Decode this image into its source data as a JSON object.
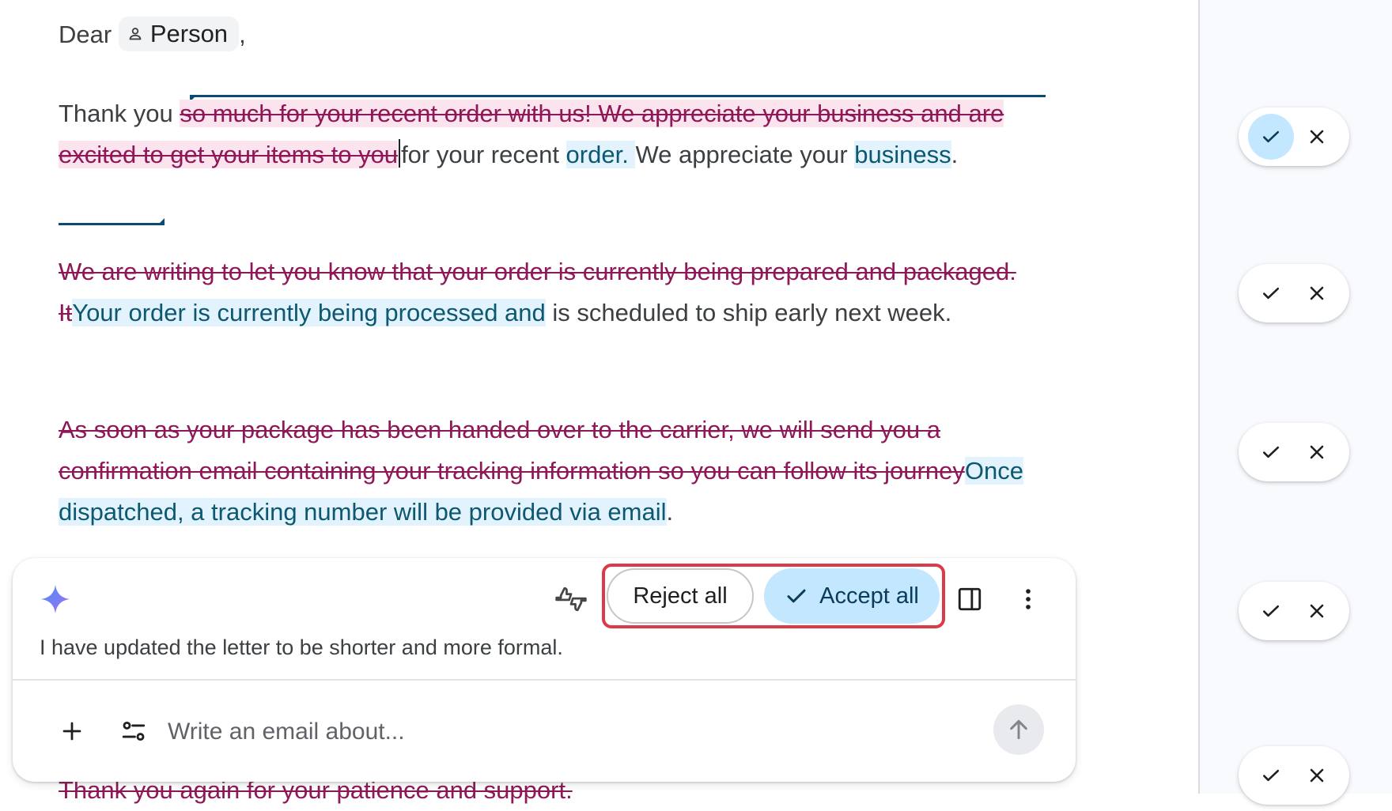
{
  "letter": {
    "greeting_word": "Dear",
    "chip_label": "Person",
    "greeting_punct": ",",
    "p1": {
      "lead": "Thank you ",
      "del1": "so much for your recent order with us! We appreciate your business and are excited to get your items to you",
      "keep1": "for your recent ",
      "ins1": "order. ",
      "keep2": "We appreciate your ",
      "ins2": "business",
      "tail": "."
    },
    "p2": {
      "del": "We are writing to let you know that your order is currently being prepared and packaged. It",
      "ins": "Your order is currently being processed and",
      "keep": " is scheduled to ship early next week."
    },
    "p3": {
      "del": "As soon as your package has been handed over to the carrier, we will send you a confirmation email containing your tracking information so you can follow its journey",
      "ins": "Once dispatched, a tracking number will be provided via email",
      "tail": "."
    },
    "p4_del": "Thank you again for your patience and support."
  },
  "rail": {
    "suggestions": [
      {
        "accept_icon": "check-icon",
        "reject_icon": "close-icon",
        "active": true
      },
      {
        "accept_icon": "check-icon",
        "reject_icon": "close-icon",
        "active": false
      },
      {
        "accept_icon": "check-icon",
        "reject_icon": "close-icon",
        "active": false
      },
      {
        "accept_icon": "check-icon",
        "reject_icon": "close-icon",
        "active": false
      },
      {
        "accept_icon": "check-icon",
        "reject_icon": "close-icon",
        "active": false
      }
    ]
  },
  "panel": {
    "reject_all_label": "Reject all",
    "accept_all_label": "Accept all",
    "response_text": "I have updated the letter to be shorter and more formal.",
    "input_placeholder": "Write an email about...",
    "icons": [
      "sparkle-icon",
      "thumbs-feedback-icon",
      "side-panel-icon",
      "more-vert-icon",
      "plus-icon",
      "tune-icon",
      "send-arrow-icon"
    ]
  },
  "colors": {
    "deleted_text": "#8e1857",
    "deleted_bg": "#fce4ef",
    "inserted_text": "#0d5870",
    "inserted_bg": "#e2f3fd",
    "accept_bg": "#c2e7ff",
    "highlight_border": "#d93b48"
  }
}
